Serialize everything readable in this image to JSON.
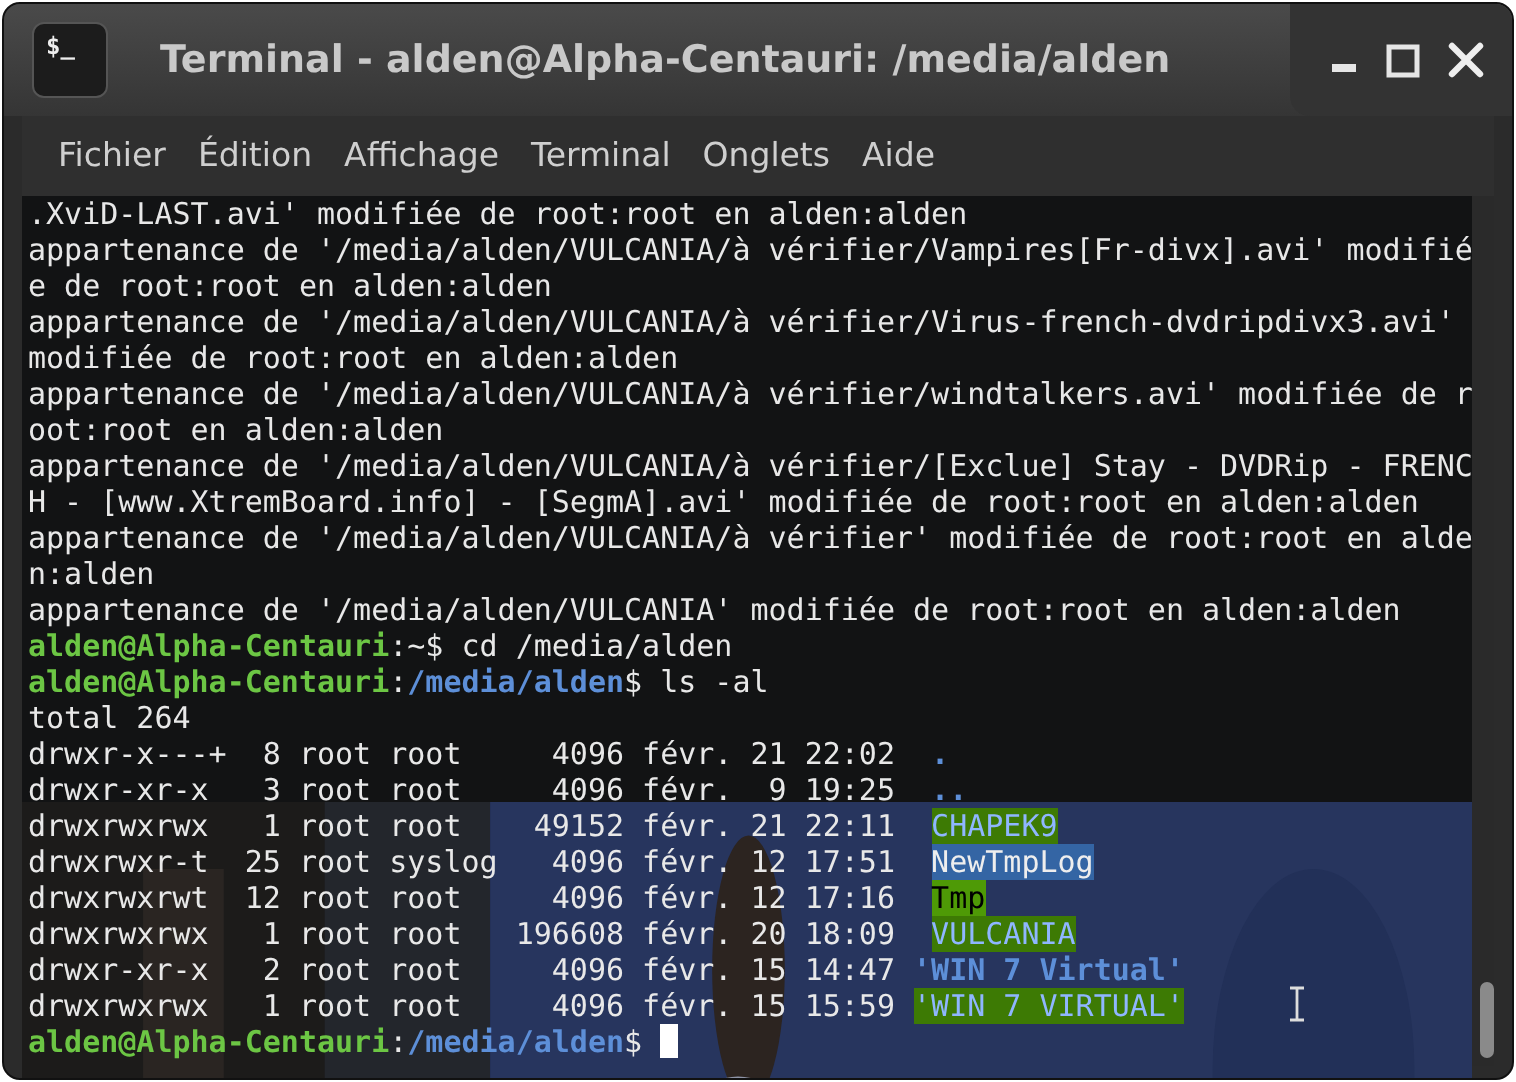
{
  "window": {
    "title": "Terminal - alden@Alpha-Centauri: /media/alden",
    "icon_text": "$_"
  },
  "menu": [
    "Fichier",
    "Édition",
    "Affichage",
    "Terminal",
    "Onglets",
    "Aide"
  ],
  "terminal": {
    "lines": [
      [
        {
          "text": ".XviD-LAST.avi' modifiée de root:root en alden:alden",
          "kind": "plain"
        }
      ],
      [
        {
          "text": "appartenance de '/media/alden/VULCANIA/à vérifier/Vampires[Fr-divx].avi' modifié",
          "kind": "plain"
        }
      ],
      [
        {
          "text": "e de root:root en alden:alden",
          "kind": "plain"
        }
      ],
      [
        {
          "text": "appartenance de '/media/alden/VULCANIA/à vérifier/Virus-french-dvdripdivx3.avi'",
          "kind": "plain"
        }
      ],
      [
        {
          "text": "modifiée de root:root en alden:alden",
          "kind": "plain"
        }
      ],
      [
        {
          "text": "appartenance de '/media/alden/VULCANIA/à vérifier/windtalkers.avi' modifiée de r",
          "kind": "plain"
        }
      ],
      [
        {
          "text": "oot:root en alden:alden",
          "kind": "plain"
        }
      ],
      [
        {
          "text": "appartenance de '/media/alden/VULCANIA/à vérifier/[Exclue] Stay - DVDRip - FRENC",
          "kind": "plain"
        }
      ],
      [
        {
          "text": "H - [www.XtremBoard.info] - [SegmA].avi' modifiée de root:root en alden:alden",
          "kind": "plain"
        }
      ],
      [
        {
          "text": "appartenance de '/media/alden/VULCANIA/à vérifier' modifiée de root:root en alde",
          "kind": "plain"
        }
      ],
      [
        {
          "text": "n:alden",
          "kind": "plain"
        }
      ],
      [
        {
          "text": "appartenance de '/media/alden/VULCANIA' modifiée de root:root en alden:alden",
          "kind": "plain"
        }
      ],
      [
        {
          "text": "alden@Alpha-Centauri",
          "kind": "user"
        },
        {
          "text": ":~$ cd /media/alden",
          "kind": "plain"
        }
      ],
      [
        {
          "text": "alden@Alpha-Centauri",
          "kind": "user"
        },
        {
          "text": ":",
          "kind": "plain"
        },
        {
          "text": "/media/alden",
          "kind": "path"
        },
        {
          "text": "$ ls -al",
          "kind": "plain"
        }
      ],
      [
        {
          "text": "total 264",
          "kind": "plain"
        }
      ],
      [
        {
          "text": "drwxr-x---+  8 root root     4096 févr. 21 22:02  ",
          "kind": "plain"
        },
        {
          "text": ".",
          "kind": "dir"
        }
      ],
      [
        {
          "text": "drwxr-xr-x   3 root root     4096 févr.  9 19:25  ",
          "kind": "plain"
        },
        {
          "text": "..",
          "kind": "dir"
        }
      ],
      [
        {
          "text": "drwxrwxrwx   1 root root    49152 févr. 21 22:11  ",
          "kind": "plain"
        },
        {
          "text": "CHAPEK9",
          "kind": "dir-other-writable"
        }
      ],
      [
        {
          "text": "drwxrwxr-t  25 root syslog   4096 févr. 12 17:51  ",
          "kind": "plain"
        },
        {
          "text": "NewTmpLog",
          "kind": "dir-sticky"
        }
      ],
      [
        {
          "text": "drwxrwxrwt  12 root root     4096 févr. 12 17:16  ",
          "kind": "plain"
        },
        {
          "text": "Tmp",
          "kind": "dir-sticky-other-writable"
        }
      ],
      [
        {
          "text": "drwxrwxrwx   1 root root   196608 févr. 20 18:09  ",
          "kind": "plain"
        },
        {
          "text": "VULCANIA",
          "kind": "dir-other-writable"
        }
      ],
      [
        {
          "text": "drwxr-xr-x   2 root root     4096 févr. 15 14:47 ",
          "kind": "plain"
        },
        {
          "text": "'WIN 7 Virtual'",
          "kind": "dir"
        }
      ],
      [
        {
          "text": "drwxrwxrwx   1 root root     4096 févr. 15 15:59 ",
          "kind": "plain"
        },
        {
          "text": "'WIN 7 VIRTUAL'",
          "kind": "dir-other-writable"
        }
      ],
      [
        {
          "text": "alden@Alpha-Centauri",
          "kind": "user"
        },
        {
          "text": ":",
          "kind": "plain"
        },
        {
          "text": "/media/alden",
          "kind": "path"
        },
        {
          "text": "$ ",
          "kind": "plain"
        },
        {
          "kind": "cursor"
        }
      ]
    ]
  }
}
